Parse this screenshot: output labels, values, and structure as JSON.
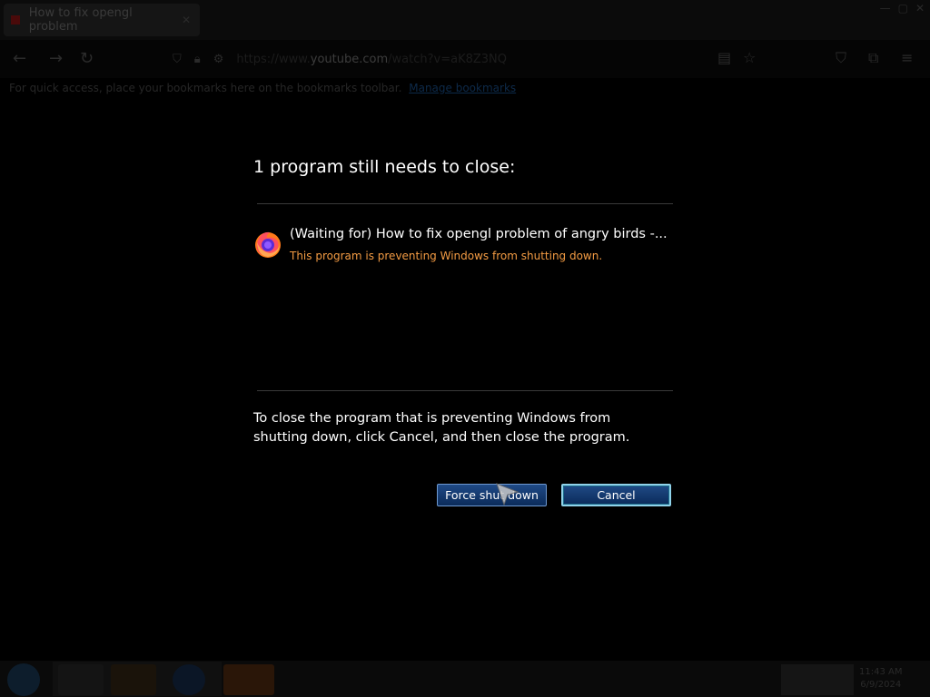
{
  "browser": {
    "tab_title": "How to fix opengl problem",
    "url_prefix": "https://www.",
    "url_host": "youtube.com",
    "url_rest": "/watch?v=aK8Z3NQ",
    "bookmark_hint": "For quick access, place your bookmarks here on the bookmarks toolbar.",
    "bookmark_link": "Manage bookmarks"
  },
  "dialog": {
    "title": "1 program still needs to close:",
    "program_name": "(Waiting for) How to fix opengl problem of angry birds -...",
    "program_status": "This program is preventing Windows from shutting down.",
    "instructions": "To close the program that is preventing Windows from shutting down, click Cancel, and then close the program.",
    "force_button": "Force shut down",
    "cancel_button": "Cancel"
  },
  "taskbar": {
    "clock_time": "11:43 AM",
    "clock_date": "6/9/2024"
  },
  "colors": {
    "status_orange": "#f39b43",
    "button_blue": "#1f4a86",
    "cancel_focus": "#8fd2ea"
  }
}
